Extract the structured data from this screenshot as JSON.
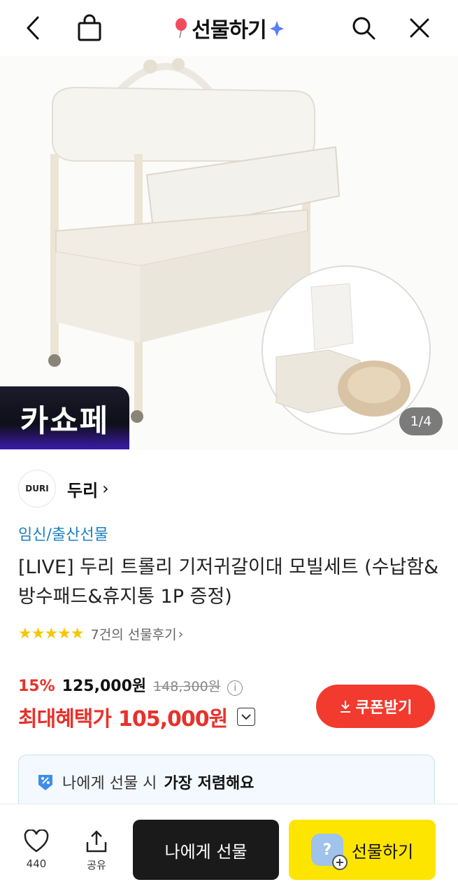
{
  "header": {
    "title": "선물하기",
    "back_icon": "chevron-left-icon",
    "bag_icon": "shopping-bag-icon",
    "search_icon": "search-icon",
    "close_icon": "close-icon"
  },
  "hero": {
    "badge": "카쇼페",
    "pager": "1/4"
  },
  "shop": {
    "logo_text": "DURI",
    "name": "두리",
    "chevron": "›"
  },
  "product": {
    "category": "임신/출산선물",
    "title": "[LIVE] 두리 트롤리 기저귀갈이대 모빌세트 (수납함&방수패드&휴지통 1P 증정)",
    "stars": "★★★★★",
    "review_text": "7건의 선물후기",
    "review_chevron": "›",
    "rating": 5
  },
  "price": {
    "discount": "15%",
    "price": "125,000원",
    "original": "148,300원",
    "info": "i",
    "best_label": "최대혜택가",
    "best_price": "105,000원",
    "coupon_label": "쿠폰받기"
  },
  "banner": {
    "text_normal": "나에게 선물 시",
    "text_bold": "가장 저렴해요"
  },
  "bottom": {
    "like_count": "440",
    "share_label": "공유",
    "self_gift_label": "나에게 선물",
    "gift_label": "선물하기",
    "avatar_symbol": "?",
    "plus": "+"
  },
  "colors": {
    "accent_red": "#e8312b",
    "kakao_yellow": "#fee500",
    "link_blue": "#1a7fc1",
    "star": "#f7c600"
  }
}
